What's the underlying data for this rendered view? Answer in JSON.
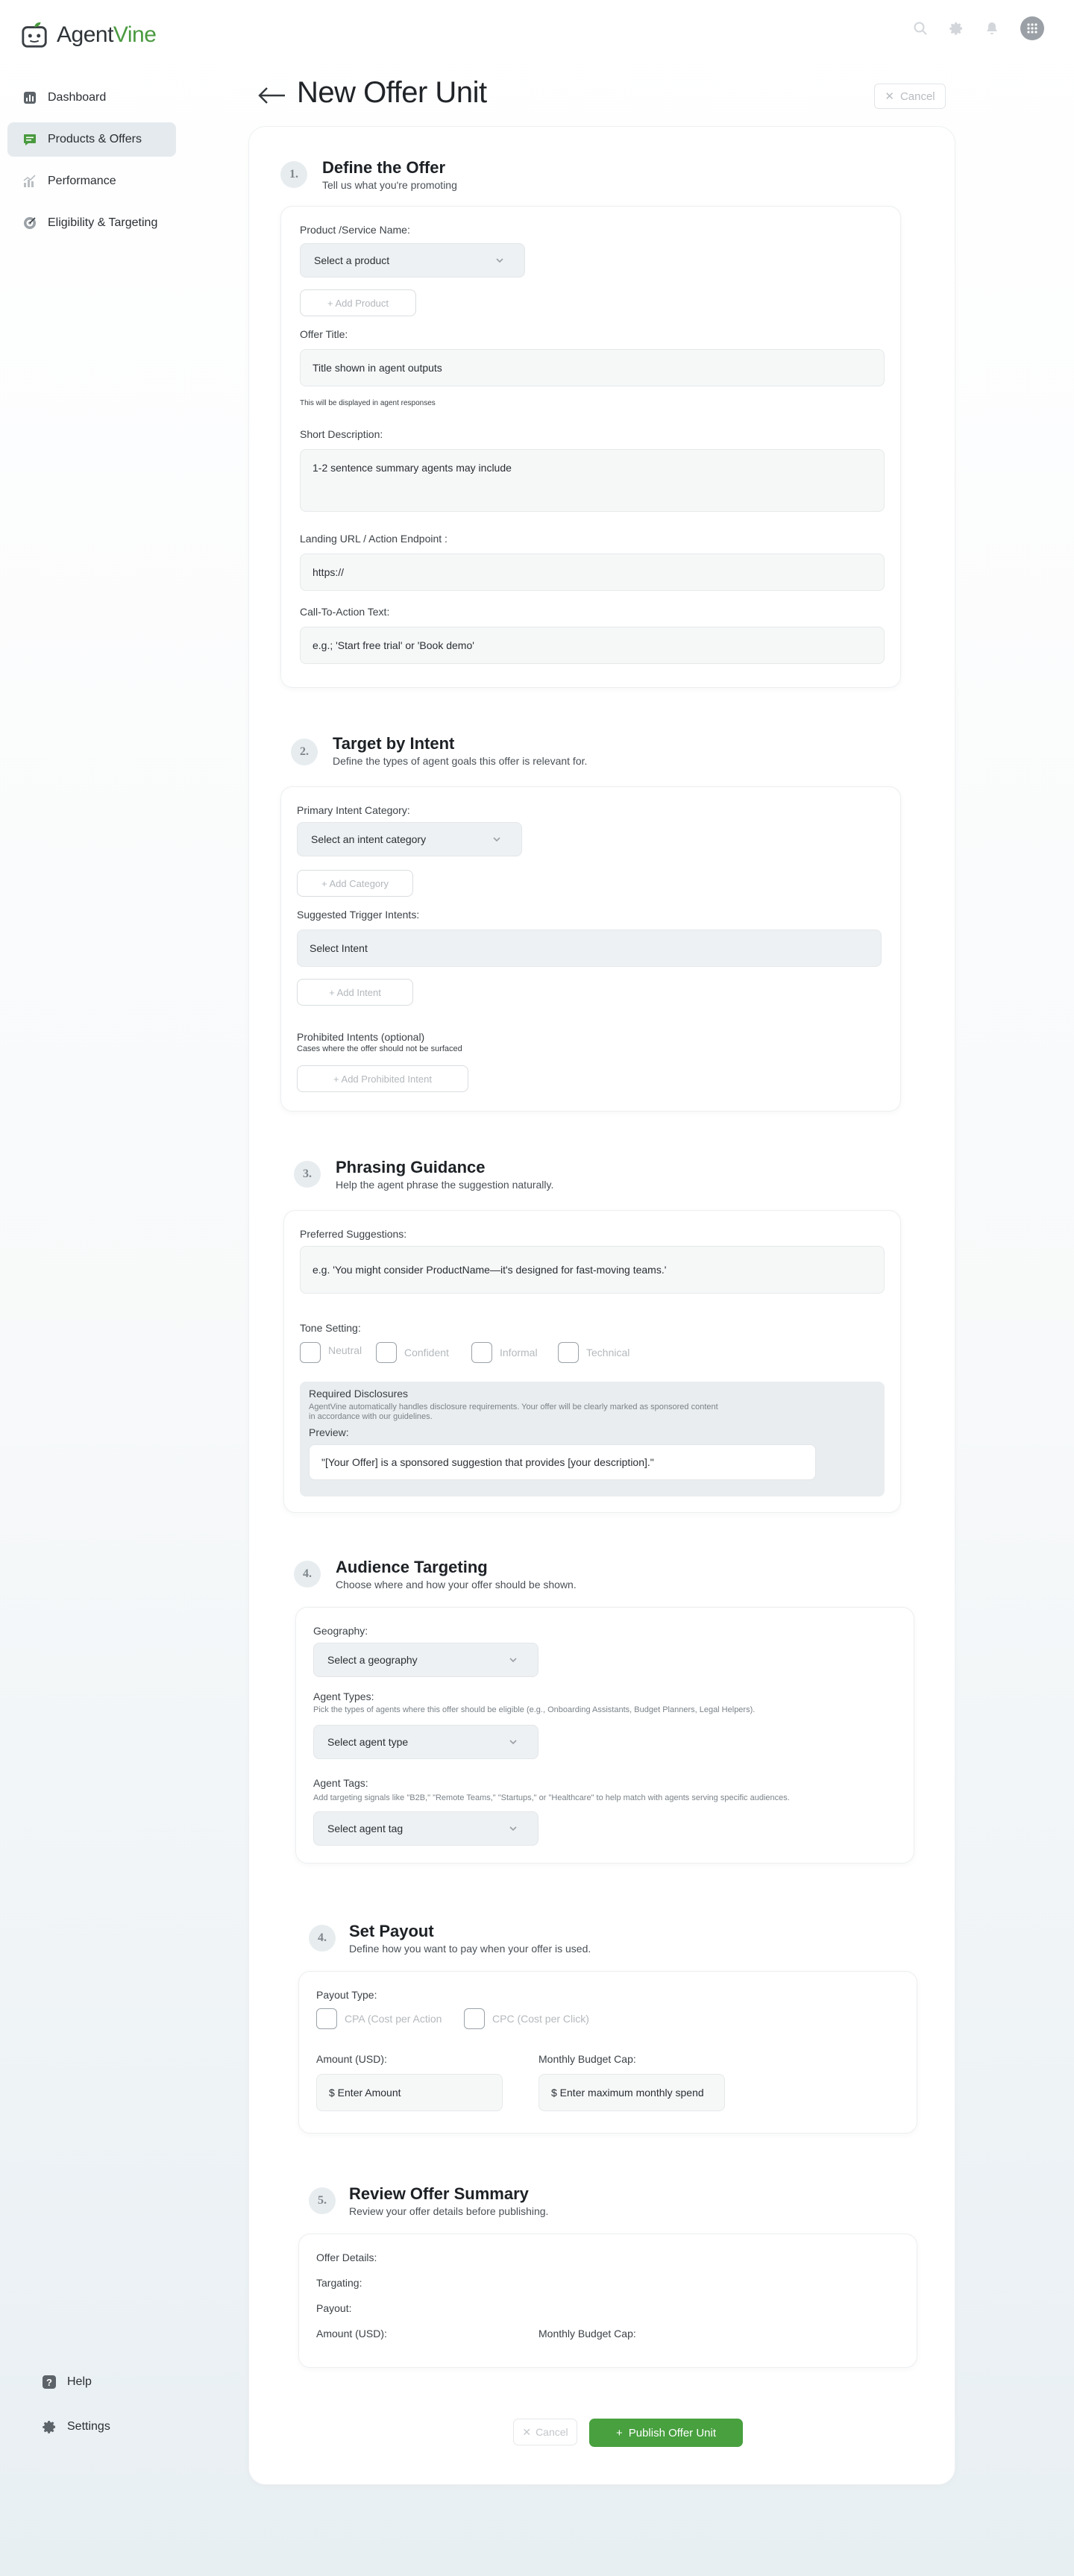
{
  "app": {
    "name_part1": "Agent",
    "name_part2": "Vine",
    "brand_color": "#4a9a3f"
  },
  "header_icons": [
    "search-icon",
    "gear-icon",
    "bell-icon",
    "avatar"
  ],
  "sidebar": {
    "items": [
      {
        "label": "Dashboard",
        "icon": "bar-chart-icon"
      },
      {
        "label": "Products & Offers",
        "icon": "chat-bubble-icon",
        "active": true
      },
      {
        "label": "Performance",
        "icon": "performance-chart-icon"
      },
      {
        "label": "Eligibility & Targeting",
        "icon": "target-icon"
      }
    ],
    "bottom": [
      {
        "label": "Help",
        "icon": "help-icon"
      },
      {
        "label": "Settings",
        "icon": "gear-icon"
      }
    ]
  },
  "page": {
    "title": "New Offer Unit",
    "cancel_label": "Cancel"
  },
  "s1": {
    "num": "1.",
    "title": "Define the Offer",
    "subtitle": "Tell us what you're promoting",
    "product_label": "Product /Service Name:",
    "product_select": "Select a product",
    "add_product": "+ Add Product",
    "offer_title_label": "Offer Title:",
    "offer_title_placeholder": "Title shown in agent outputs",
    "offer_title_helper": "This will be displayed in agent responses",
    "desc_label": "Short Description:",
    "desc_placeholder": "1-2 sentence summary agents may include",
    "url_label": "Landing URL / Action Endpoint :",
    "url_placeholder": "https://",
    "cta_label": "Call-To-Action Text:",
    "cta_placeholder": "e.g.; 'Start free trial' or 'Book demo'"
  },
  "s2": {
    "num": "2.",
    "title": "Target by Intent",
    "subtitle": "Define the types of agent goals this offer is relevant for.",
    "primary_label": "Primary Intent Category:",
    "primary_select": "Select an intent category",
    "add_category": "+ Add Category",
    "trigger_label": "Suggested Trigger Intents:",
    "trigger_select": "Select Intent",
    "add_intent": "+ Add Intent",
    "prohibited_label": "Prohibited Intents (optional)",
    "prohibited_note": "Cases where the offer should not be surfaced",
    "add_prohibited": "+ Add Prohibited Intent"
  },
  "s3": {
    "num": "3.",
    "title": "Phrasing Guidance",
    "subtitle": "Help the agent phrase the suggestion naturally.",
    "preferred_label": "Preferred Suggestions:",
    "preferred_placeholder": "e.g. 'You might consider ProductName—it's designed for fast-moving teams.'",
    "tone_label": "Tone Setting:",
    "tones": [
      "Neutral",
      "Confident",
      "Informal",
      "Technical"
    ],
    "disclosure_title": "Required Disclosures",
    "disclosure_text1": "AgentVine automatically handles disclosure requirements. Your offer will be clearly marked as sponsored content",
    "disclosure_text2": "in accordance with our guidelines.",
    "preview_label": "Preview:",
    "preview_text": "\"[Your Offer] is a sponsored suggestion that provides [your description].\""
  },
  "s4": {
    "num": "4.",
    "title": "Audience Targeting",
    "subtitle": "Choose where and how your offer should be shown.",
    "geo_label": "Geography:",
    "geo_select": "Select a geography",
    "agent_types_label": "Agent Types:",
    "agent_types_note": "Pick the types of agents where this offer should be eligible (e.g., Onboarding Assistants, Budget Planners, Legal Helpers).",
    "agent_type_select": "Select agent type",
    "agent_tags_label": "Agent Tags:",
    "agent_tags_note": "Add targeting signals like \"B2B,\" \"Remote Teams,\" \"Startups,\" or \"Healthcare\" to help match with agents serving specific audiences.",
    "agent_tag_select": "Select agent tag"
  },
  "s5": {
    "num": "4.",
    "title": "Set Payout",
    "subtitle": "Define how you want to pay when your offer is used.",
    "payout_type_label": "Payout Type:",
    "payout_types": [
      "CPA (Cost per Action",
      "CPC (Cost per Click)"
    ],
    "amount_label": "Amount (USD):",
    "amount_placeholder": "$ Enter Amount",
    "budget_label": "Monthly Budget Cap:",
    "budget_placeholder": "$ Enter maximum monthly spend"
  },
  "s6": {
    "num": "5.",
    "title": "Review Offer Summary",
    "subtitle": "Review your offer details before publishing.",
    "offer_details_label": "Offer Details:",
    "targeting_label": "Targating:",
    "payout_label": "Payout:",
    "amount_label": "Amount (USD):",
    "budget_label": "Monthly Budget Cap:"
  },
  "footer": {
    "cancel_label": "Cancel",
    "publish_label": "Publish Offer Unit"
  }
}
